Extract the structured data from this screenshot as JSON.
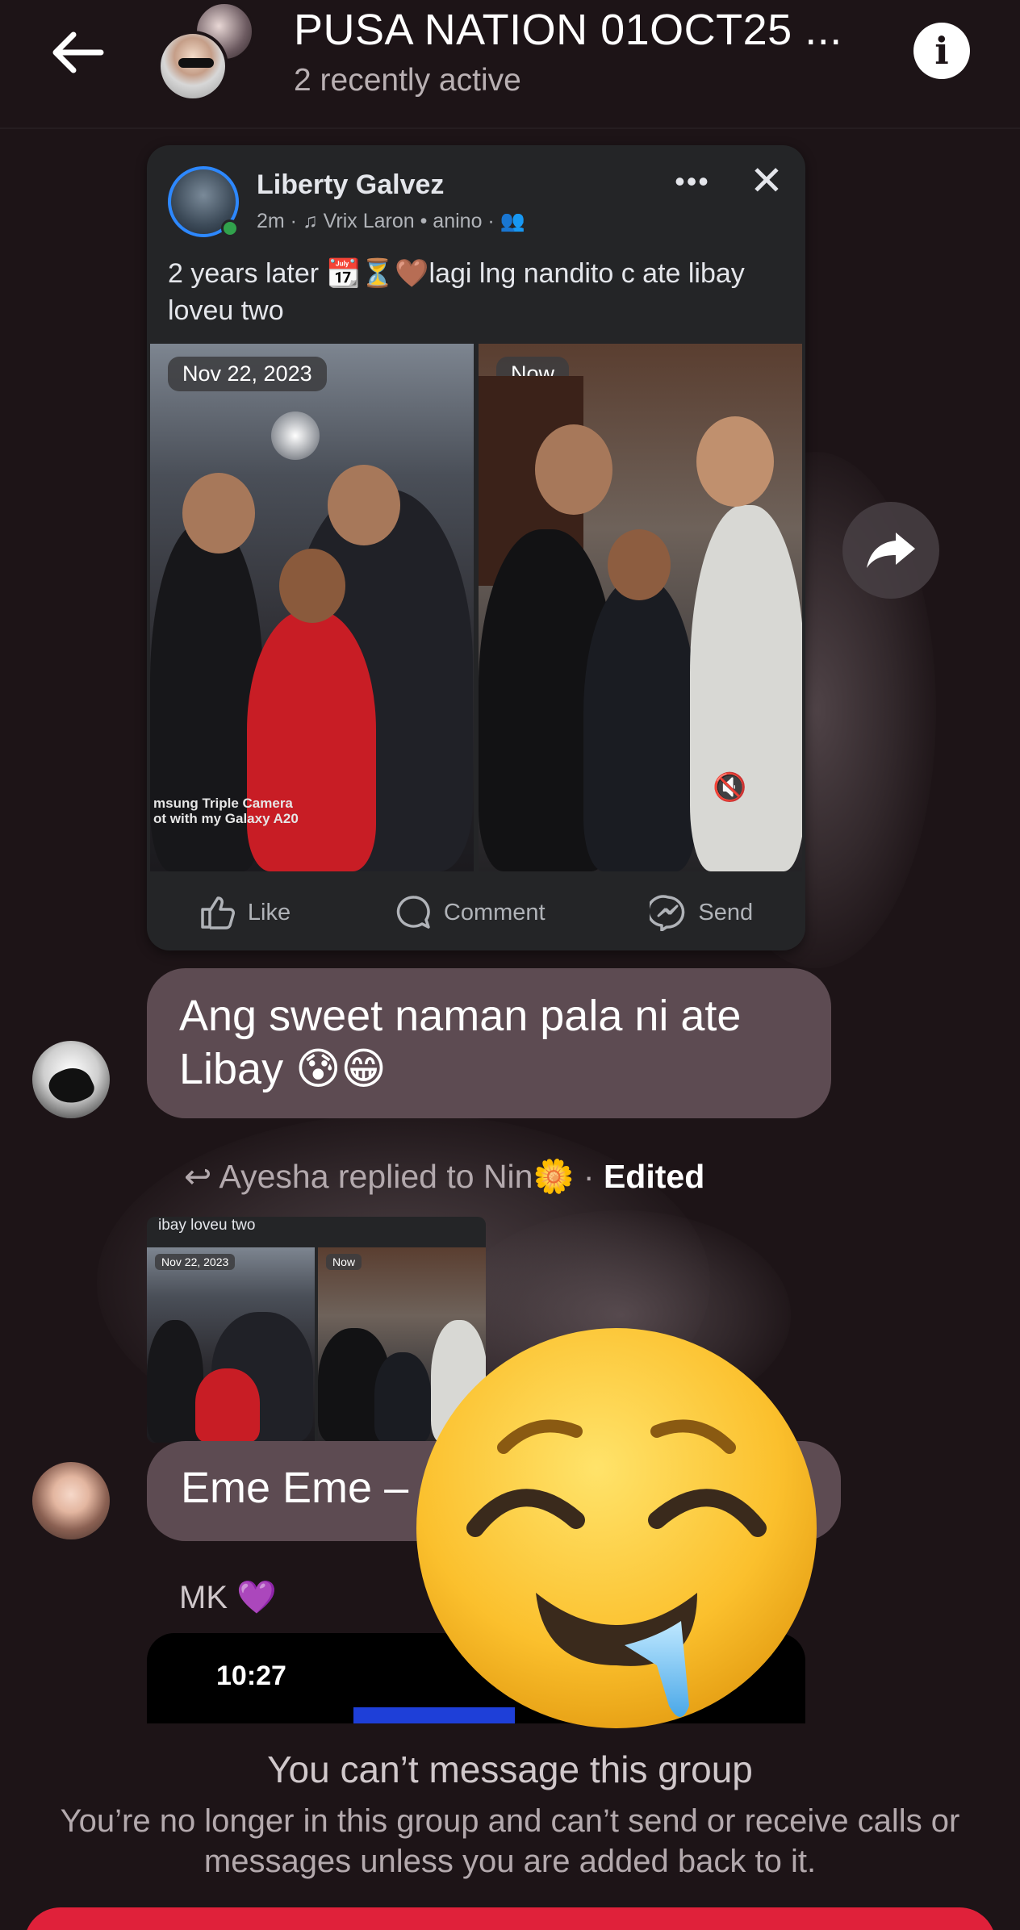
{
  "header": {
    "title": "PUSA NATION 01OCT25 ...",
    "subtitle": "2 recently active",
    "back_icon": "arrow-left-icon",
    "info_icon": "info-icon"
  },
  "shared_post": {
    "author": "Liberty Galvez",
    "meta": "2m · ♫ Vrix Laron • anino · ",
    "text": "2 years later 📆⏳🤎lagi lng nandito c ate libay loveu two",
    "more_label": "•••",
    "close_label": "✕",
    "photos": [
      {
        "tag": "Nov 22, 2023"
      },
      {
        "tag": "Now"
      }
    ],
    "watermark_line1": "msung Triple Camera",
    "watermark_line2": "ot with my Galaxy A20",
    "actions": [
      {
        "label": "Like",
        "icon": "thumbs-up-icon"
      },
      {
        "label": "Comment",
        "icon": "comment-icon"
      },
      {
        "label": "Send",
        "icon": "messenger-icon"
      }
    ]
  },
  "messages": {
    "msg1_text": "Ang sweet naman pala ni ate Libay 😰😁",
    "reply_prefix": "Ayesha replied to Nin🌼",
    "reply_sep": " · ",
    "reply_edited": "Edited",
    "reply_thumb_text": "ibay loveu two",
    "reply_thumb_tags": [
      "Nov 22, 2023",
      "Now"
    ],
    "msg2_text": "Eme Eme –",
    "next_sender": "MK 💜",
    "attachment_time": "10:27"
  },
  "overlay_emoji": "drooling-face",
  "footer": {
    "title": "You can’t message this group",
    "description": "You’re no longer in this group and can’t send or receive calls or messages unless you are added back to it."
  },
  "colors": {
    "background": "#1d1417",
    "bubble": "#5d4b52",
    "card": "#242527",
    "accent_red": "#e0213a"
  }
}
